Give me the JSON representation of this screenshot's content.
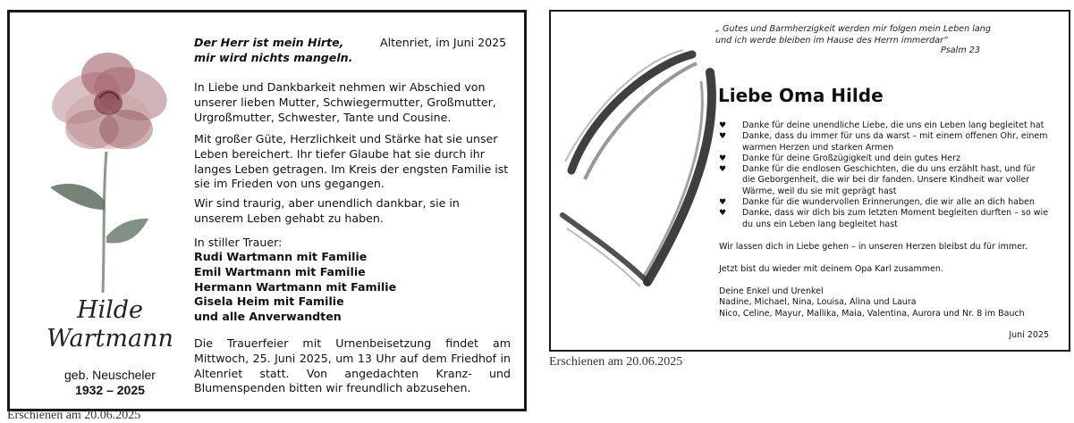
{
  "left_notice": {
    "verse": [
      "Der Herr ist mein Hirte,",
      "mir wird nichts mangeln."
    ],
    "place_date": "Altenriet, im Juni 2025",
    "para1": "In Liebe und Dankbarkeit nehmen wir Abschied von unserer lieben Mutter, Schwiegermutter, Großmutter, Urgroßmutter, Schwester, Tante und Cousine.",
    "para2": "Mit großer Güte, Herzlichkeit und Stärke hat sie unser Leben bereichert. Ihr tiefer Glaube hat sie durch ihr langes Leben getragen. Im Kreis der engsten Familie ist sie im Frieden von uns gegangen.",
    "para3": "Wir sind traurig, aber unendlich dankbar, sie in unserem Leben gehabt zu haben.",
    "mourning_intro": "In stiller Trauer:",
    "mourners": [
      "Rudi Wartmann mit Familie",
      "Emil Wartmann mit Familie",
      "Hermann Wartmann mit Familie",
      "Gisela Heim mit Familie",
      "und alle Anverwandten"
    ],
    "funeral": "Die Trauerfeier mit Urnenbeisetzung findet am Mittwoch, 25. Juni 2025, um 13 Uhr auf dem Friedhof in Altenriet statt. Von angedachten Kranz- und Blumenspenden bitten wir freundlich abzusehen.",
    "name_first": "Hilde",
    "name_last": "Wartmann",
    "birth_name": "geb. Neuscheler",
    "years": "1932 – 2025",
    "caption": "Erschienen am 20.06.2025"
  },
  "right_notice": {
    "quote": [
      "„ Gutes und Barmherzigkeit werden mir folgen mein Leben lang",
      "und ich werde bleiben im Hause des Herrn immerdar“"
    ],
    "psalm": "Psalm 23",
    "title": "Liebe Oma Hilde",
    "bullet_glyph": "♥",
    "items": [
      "Danke für deine unendliche Liebe, die uns ein Leben lang begleitet hat",
      "Danke, dass du immer für uns da warst – mit einem offenen Ohr, einem warmen Herzen und starken Armen",
      "Danke für deine Großzügigkeit und dein gutes Herz",
      "Danke für die endlosen Geschichten, die du uns erzählt hast, und für die Geborgenheit, die wir bei dir fanden. Unsere Kindheit war voller Wärme, weil du sie mit geprägt hast",
      "Danke für die wundervollen Erinnerungen, die wir alle an dich haben",
      "Danke, dass wir dich bis zum letzten Moment begleiten durften – so wie du uns ein Leben lang begleitet hast"
    ],
    "para1": "Wir lassen dich in Liebe gehen – in unseren Herzen bleibst du für immer.",
    "para2": "Jetzt bist du wieder mit deinem Opa Karl zusammen.",
    "sign_intro": "Deine Enkel und Urenkel",
    "sign_line1": "Nadine, Michael, Nina, Louisa, Alina und Laura",
    "sign_line2": "Nico, Celine, Mayur, Mallika, Maia, Valentina, Aurora und Nr. 8 im Bauch",
    "date": "Juni 2025",
    "caption": "Erschienen am 20.06.2025"
  }
}
